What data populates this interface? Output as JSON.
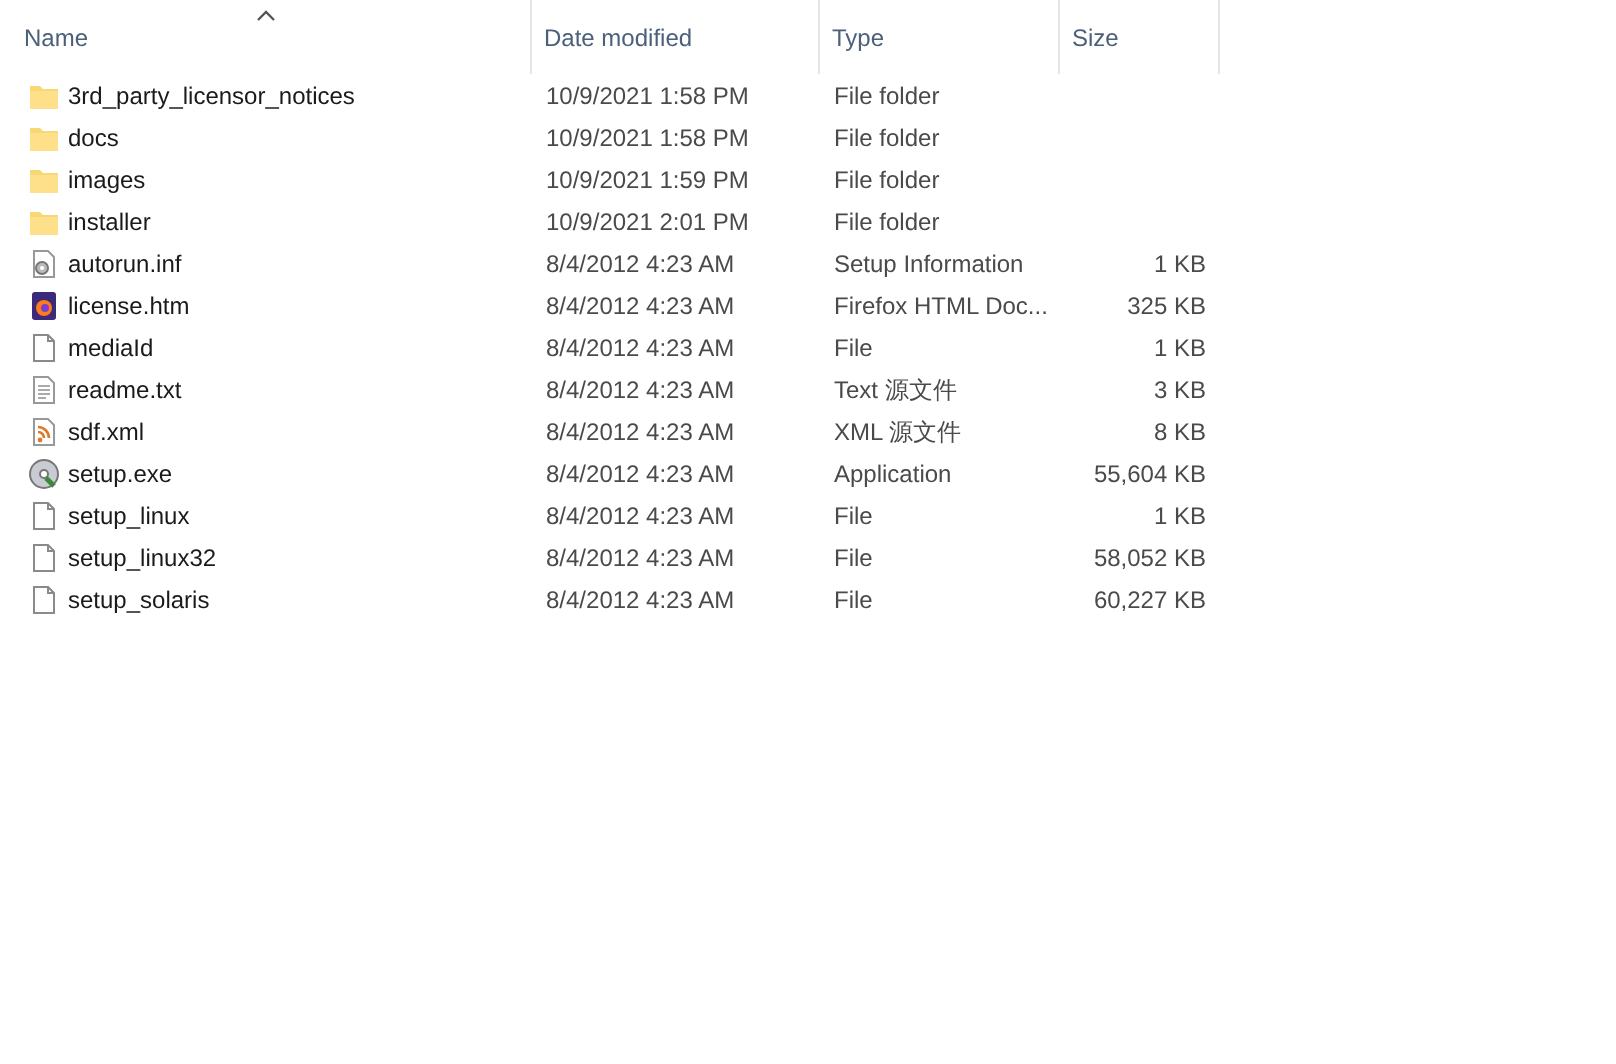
{
  "columns": [
    {
      "label": "Name",
      "sorted": true
    },
    {
      "label": "Date modified",
      "sorted": false
    },
    {
      "label": "Type",
      "sorted": false
    },
    {
      "label": "Size",
      "sorted": false
    }
  ],
  "rows": [
    {
      "kind": "folder",
      "name": "3rd_party_licensor_notices",
      "date": "10/9/2021 1:58 PM",
      "type": "File folder"
    },
    {
      "kind": "folder",
      "name": "docs",
      "date": "10/9/2021 1:58 PM",
      "type": "File folder"
    },
    {
      "kind": "folder",
      "name": "images",
      "date": "10/9/2021 1:59 PM",
      "type": "File folder"
    },
    {
      "kind": "folder",
      "name": "installer",
      "date": "10/9/2021 2:01 PM",
      "type": "File folder"
    },
    {
      "kind": "settings",
      "name": "autorun.inf",
      "date": "8/4/2012 4:23 AM",
      "type": "Setup Information",
      "size": "1 KB"
    },
    {
      "kind": "browser",
      "name": "license.htm",
      "date": "8/4/2012 4:23 AM",
      "type": "Firefox HTML Doc...",
      "size": "325 KB"
    },
    {
      "kind": "file",
      "name": "mediaId",
      "date": "8/4/2012 4:23 AM",
      "type": "File",
      "size": "1 KB"
    },
    {
      "kind": "text",
      "name": "readme.txt",
      "date": "8/4/2012 4:23 AM",
      "type": "Text 源文件",
      "size": "3 KB"
    },
    {
      "kind": "feed",
      "name": "sdf.xml",
      "date": "8/4/2012 4:23 AM",
      "type": "XML 源文件",
      "size": "8 KB"
    },
    {
      "kind": "app",
      "name": "setup.exe",
      "date": "8/4/2012 4:23 AM",
      "type": "Application",
      "size": "55,604 KB"
    },
    {
      "kind": "file",
      "name": "setup_linux",
      "date": "8/4/2012 4:23 AM",
      "type": "File",
      "size": "1 KB"
    },
    {
      "kind": "file",
      "name": "setup_linux32",
      "date": "8/4/2012 4:23 AM",
      "type": "File",
      "size": "58,052 KB"
    },
    {
      "kind": "file",
      "name": "setup_solaris",
      "date": "8/4/2012 4:23 AM",
      "type": "File",
      "size": "60,227 KB"
    }
  ]
}
